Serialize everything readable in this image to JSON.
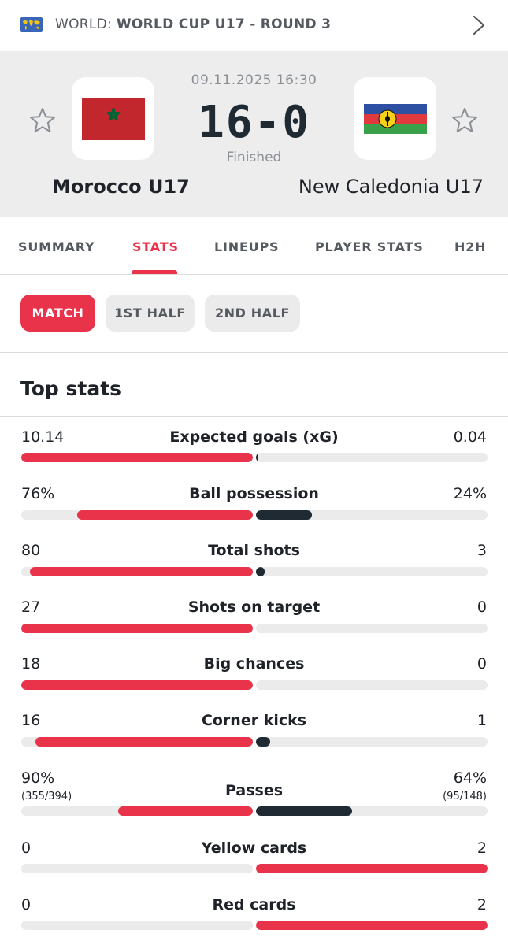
{
  "competition": {
    "country": "WORLD:",
    "name": "WORLD CUP U17 - ROUND 3",
    "flag_icon": "world-map-icon"
  },
  "match": {
    "datetime": "09.11.2025 16:30",
    "score": "16-0",
    "status": "Finished",
    "home": {
      "name": "Morocco U17",
      "logo": "morocco-flag"
    },
    "away": {
      "name": "New Caledonia U17",
      "logo": "new-caledonia-flag"
    }
  },
  "tabs": [
    {
      "label": "SUMMARY",
      "active": false
    },
    {
      "label": "STATS",
      "active": true
    },
    {
      "label": "LINEUPS",
      "active": false
    },
    {
      "label": "PLAYER STATS",
      "active": false
    },
    {
      "label": "H2H",
      "active": false
    }
  ],
  "periods": [
    {
      "label": "MATCH",
      "active": true
    },
    {
      "label": "1ST HALF",
      "active": false
    },
    {
      "label": "2ND HALF",
      "active": false
    }
  ],
  "section_title": "Top stats",
  "colors": {
    "accent": "#e8334a",
    "dark": "#1f2a33",
    "track": "#ebebeb"
  },
  "stats": [
    {
      "label": "Expected goals (xG)",
      "home": "10.14",
      "away": "0.04",
      "home_share": 1.0,
      "away_share": 0.004,
      "home_color": "#e8334a",
      "away_color": "#1f2a33"
    },
    {
      "label": "Ball possession",
      "home": "76%",
      "away": "24%",
      "home_share": 0.76,
      "away_share": 0.24,
      "home_color": "#e8334a",
      "away_color": "#1f2a33"
    },
    {
      "label": "Total shots",
      "home": "80",
      "away": "3",
      "home_share": 0.964,
      "away_share": 0.036,
      "home_color": "#e8334a",
      "away_color": "#1f2a33"
    },
    {
      "label": "Shots on target",
      "home": "27",
      "away": "0",
      "home_share": 1.0,
      "away_share": 0,
      "home_color": "#e8334a",
      "away_color": "#1f2a33"
    },
    {
      "label": "Big chances",
      "home": "18",
      "away": "0",
      "home_share": 1.0,
      "away_share": 0,
      "home_color": "#e8334a",
      "away_color": "#1f2a33"
    },
    {
      "label": "Corner kicks",
      "home": "16",
      "away": "1",
      "home_share": 0.94,
      "away_share": 0.06,
      "home_color": "#e8334a",
      "away_color": "#1f2a33"
    },
    {
      "label": "Passes",
      "home": "90%",
      "away": "64%",
      "home_sub": "(355/394)",
      "away_sub": "(95/148)",
      "home_share": 0.58,
      "away_share": 0.415,
      "home_color": "#e8334a",
      "away_color": "#1f2a33"
    },
    {
      "label": "Yellow cards",
      "home": "0",
      "away": "2",
      "home_share": 0,
      "away_share": 1.0,
      "home_color": "#e8334a",
      "away_color": "#e8334a"
    },
    {
      "label": "Red cards",
      "home": "0",
      "away": "2",
      "home_share": 0,
      "away_share": 1.0,
      "home_color": "#e8334a",
      "away_color": "#e8334a"
    }
  ]
}
